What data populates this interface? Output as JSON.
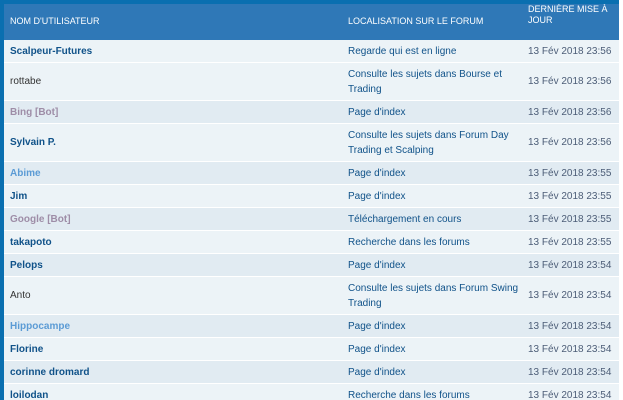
{
  "header": {
    "username": "NOM D'UTILISATEUR",
    "location": "LOCALISATION SUR LE FORUM",
    "updated": "DERNIÈRE MISE À JOUR"
  },
  "rows": [
    {
      "user": "Scalpeur-Futures",
      "loc": "Regarde qui est en ligne",
      "time": "13 Fév 2018 23:56"
    },
    {
      "user": "rottabe",
      "loc": "Consulte les sujets dans Bourse et Trading",
      "time": "13 Fév 2018 23:56"
    },
    {
      "user": "Bing [Bot]",
      "loc": "Page d'index",
      "time": "13 Fév 2018 23:56"
    },
    {
      "user": "Sylvain P.",
      "loc": "Consulte les sujets dans Forum Day Trading et Scalping",
      "time": "13 Fév 2018 23:56"
    },
    {
      "user": "Abime",
      "loc": "Page d'index",
      "time": "13 Fév 2018 23:55"
    },
    {
      "user": "Jim",
      "loc": "Page d'index",
      "time": "13 Fév 2018 23:55"
    },
    {
      "user": "Google [Bot]",
      "loc": "Téléchargement en cours",
      "time": "13 Fév 2018 23:55"
    },
    {
      "user": "takapoto",
      "loc": "Recherche dans les forums",
      "time": "13 Fév 2018 23:55"
    },
    {
      "user": "Pelops",
      "loc": "Page d'index",
      "time": "13 Fév 2018 23:54"
    },
    {
      "user": "Anto",
      "loc": "Consulte les sujets dans Forum Swing Trading",
      "time": "13 Fév 2018 23:54"
    },
    {
      "user": "Hippocampe",
      "loc": "Page d'index",
      "time": "13 Fév 2018 23:54"
    },
    {
      "user": "Florine",
      "loc": "Page d'index",
      "time": "13 Fév 2018 23:54"
    },
    {
      "user": "corinne dromard",
      "loc": "Page d'index",
      "time": "13 Fév 2018 23:54"
    },
    {
      "user": "loilodan",
      "loc": "Recherche dans les forums",
      "time": "13 Fév 2018 23:54"
    }
  ]
}
